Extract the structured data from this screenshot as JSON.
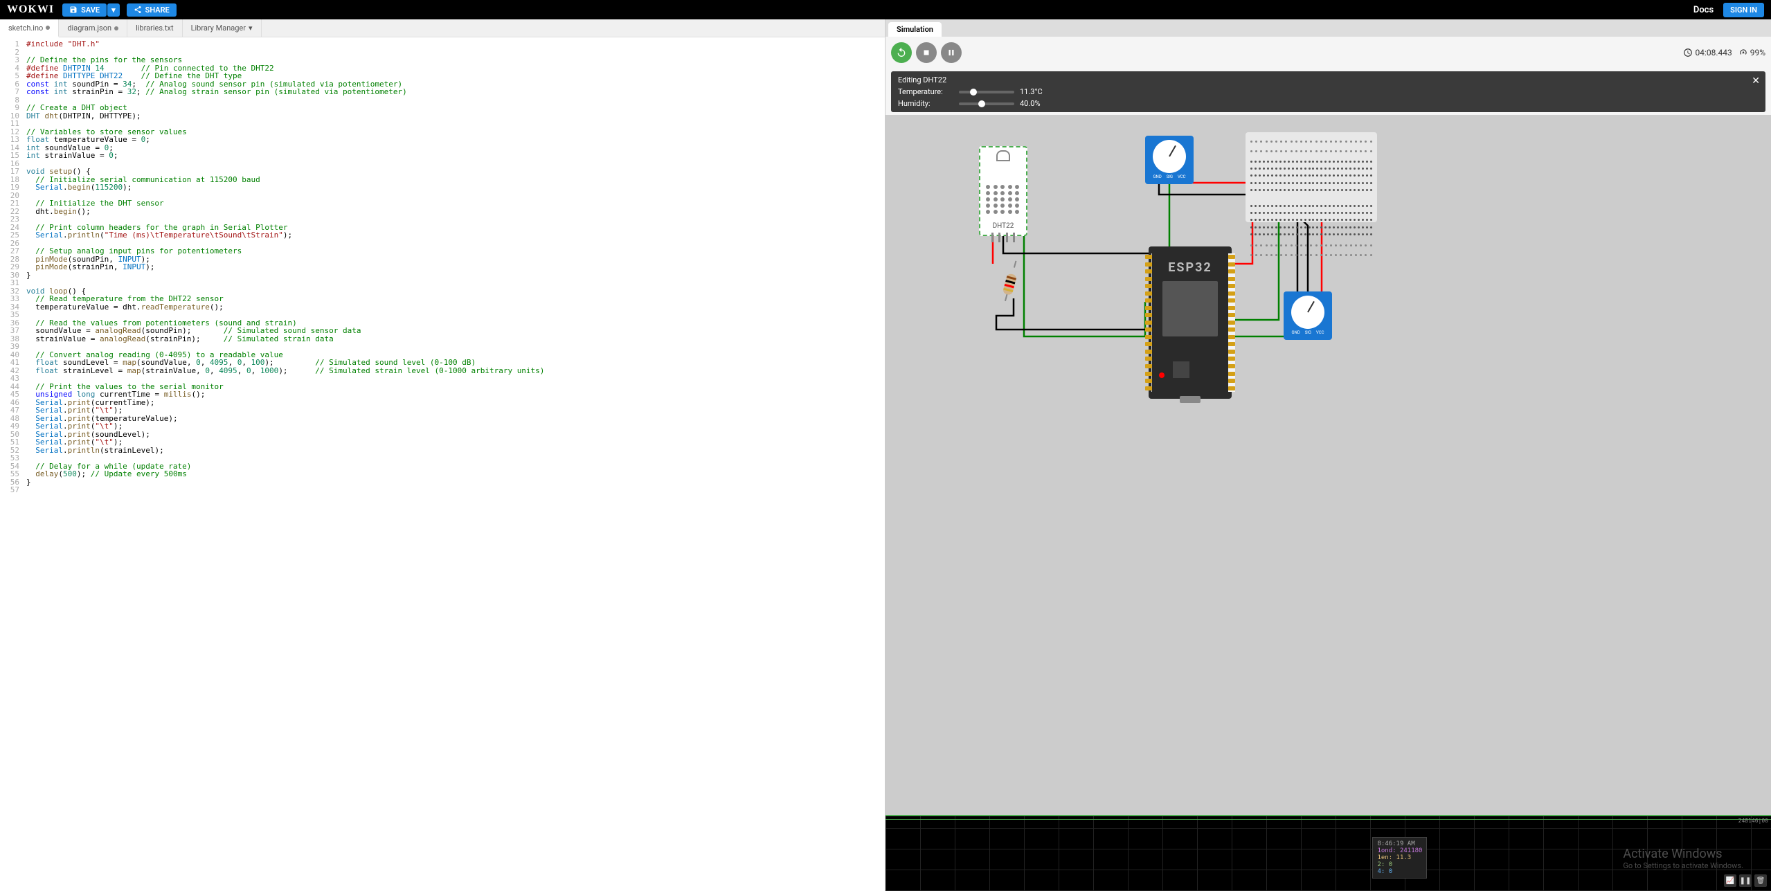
{
  "header": {
    "logo": "WOKWI",
    "save": "SAVE",
    "share": "SHARE",
    "docs": "Docs",
    "signin": "SIGN IN"
  },
  "tabs": [
    {
      "label": "sketch.ino",
      "dirty": true,
      "active": true
    },
    {
      "label": "diagram.json",
      "dirty": true,
      "active": false
    },
    {
      "label": "libraries.txt",
      "dirty": false,
      "active": false
    },
    {
      "label": "Library Manager",
      "dirty": false,
      "active": false,
      "dropdown": true
    }
  ],
  "code_lines": [
    {
      "n": 1,
      "html": "<span class='tk-pp'>#include</span> <span class='tk-str'>\"DHT.h\"</span>"
    },
    {
      "n": 2,
      "html": ""
    },
    {
      "n": 3,
      "html": "<span class='tk-cm'>// Define the pins for the sensors</span>"
    },
    {
      "n": 4,
      "html": "<span class='tk-pp'>#define</span> <span class='tk-const'>DHTPIN</span> <span class='tk-num'>14</span>        <span class='tk-cm'>// Pin connected to the DHT22</span>"
    },
    {
      "n": 5,
      "html": "<span class='tk-pp'>#define</span> <span class='tk-const'>DHTTYPE</span> <span class='tk-const'>DHT22</span>    <span class='tk-cm'>// Define the DHT type</span>"
    },
    {
      "n": 6,
      "html": "<span class='tk-kw'>const</span> <span class='tk-ty'>int</span> soundPin = <span class='tk-num'>34</span>;  <span class='tk-cm'>// Analog sound sensor pin (simulated via potentiometer)</span>"
    },
    {
      "n": 7,
      "html": "<span class='tk-kw'>const</span> <span class='tk-ty'>int</span> strainPin = <span class='tk-num'>32</span>; <span class='tk-cm'>// Analog strain sensor pin (simulated via potentiometer)</span>"
    },
    {
      "n": 8,
      "html": ""
    },
    {
      "n": 9,
      "html": "<span class='tk-cm'>// Create a DHT object</span>"
    },
    {
      "n": 10,
      "html": "<span class='tk-ty'>DHT</span> <span class='tk-fn'>dht</span>(DHTPIN, DHTTYPE);"
    },
    {
      "n": 11,
      "html": ""
    },
    {
      "n": 12,
      "html": "<span class='tk-cm'>// Variables to store sensor values</span>"
    },
    {
      "n": 13,
      "html": "<span class='tk-ty'>float</span> temperatureValue = <span class='tk-num'>0</span>;"
    },
    {
      "n": 14,
      "html": "<span class='tk-ty'>int</span> soundValue = <span class='tk-num'>0</span>;"
    },
    {
      "n": 15,
      "html": "<span class='tk-ty'>int</span> strainValue = <span class='tk-num'>0</span>;"
    },
    {
      "n": 16,
      "html": ""
    },
    {
      "n": 17,
      "html": "<span class='tk-ty'>void</span> <span class='tk-fn'>setup</span>() {"
    },
    {
      "n": 18,
      "html": "  <span class='tk-cm'>// Initialize serial communication at 115200 baud</span>"
    },
    {
      "n": 19,
      "html": "  <span class='tk-const'>Serial</span>.<span class='tk-fn'>begin</span>(<span class='tk-num'>115200</span>);"
    },
    {
      "n": 20,
      "html": ""
    },
    {
      "n": 21,
      "html": "  <span class='tk-cm'>// Initialize the DHT sensor</span>"
    },
    {
      "n": 22,
      "html": "  dht.<span class='tk-fn'>begin</span>();"
    },
    {
      "n": 23,
      "html": ""
    },
    {
      "n": 24,
      "html": "  <span class='tk-cm'>// Print column headers for the graph in Serial Plotter</span>"
    },
    {
      "n": 25,
      "html": "  <span class='tk-const'>Serial</span>.<span class='tk-fn'>println</span>(<span class='tk-str'>\"Time (ms)\\tTemperature\\tSound\\tStrain\"</span>);"
    },
    {
      "n": 26,
      "html": ""
    },
    {
      "n": 27,
      "html": "  <span class='tk-cm'>// Setup analog input pins for potentiometers</span>"
    },
    {
      "n": 28,
      "html": "  <span class='tk-fn'>pinMode</span>(soundPin, <span class='tk-const'>INPUT</span>);"
    },
    {
      "n": 29,
      "html": "  <span class='tk-fn'>pinMode</span>(strainPin, <span class='tk-const'>INPUT</span>);"
    },
    {
      "n": 30,
      "html": "}"
    },
    {
      "n": 31,
      "html": ""
    },
    {
      "n": 32,
      "html": "<span class='tk-ty'>void</span> <span class='tk-fn'>loop</span>() {"
    },
    {
      "n": 33,
      "html": "  <span class='tk-cm'>// Read temperature from the DHT22 sensor</span>"
    },
    {
      "n": 34,
      "html": "  temperatureValue = dht.<span class='tk-fn'>readTemperature</span>();"
    },
    {
      "n": 35,
      "html": ""
    },
    {
      "n": 36,
      "html": "  <span class='tk-cm'>// Read the values from potentiometers (sound and strain)</span>"
    },
    {
      "n": 37,
      "html": "  soundValue = <span class='tk-fn'>analogRead</span>(soundPin);       <span class='tk-cm'>// Simulated sound sensor data</span>"
    },
    {
      "n": 38,
      "html": "  strainValue = <span class='tk-fn'>analogRead</span>(strainPin);     <span class='tk-cm'>// Simulated strain data</span>"
    },
    {
      "n": 39,
      "html": ""
    },
    {
      "n": 40,
      "html": "  <span class='tk-cm'>// Convert analog reading (0-4095) to a readable value</span>"
    },
    {
      "n": 41,
      "html": "  <span class='tk-ty'>float</span> soundLevel = <span class='tk-fn'>map</span>(soundValue, <span class='tk-num'>0</span>, <span class='tk-num'>4095</span>, <span class='tk-num'>0</span>, <span class='tk-num'>100</span>);         <span class='tk-cm'>// Simulated sound level (0-100 dB)</span>"
    },
    {
      "n": 42,
      "html": "  <span class='tk-ty'>float</span> strainLevel = <span class='tk-fn'>map</span>(strainValue, <span class='tk-num'>0</span>, <span class='tk-num'>4095</span>, <span class='tk-num'>0</span>, <span class='tk-num'>1000</span>);      <span class='tk-cm'>// Simulated strain level (0-1000 arbitrary units)</span>"
    },
    {
      "n": 43,
      "html": ""
    },
    {
      "n": 44,
      "html": "  <span class='tk-cm'>// Print the values to the serial monitor</span>"
    },
    {
      "n": 45,
      "html": "  <span class='tk-kw'>unsigned</span> <span class='tk-ty'>long</span> currentTime = <span class='tk-fn'>millis</span>();"
    },
    {
      "n": 46,
      "html": "  <span class='tk-const'>Serial</span>.<span class='tk-fn'>print</span>(currentTime);"
    },
    {
      "n": 47,
      "html": "  <span class='tk-const'>Serial</span>.<span class='tk-fn'>print</span>(<span class='tk-str'>\"\\t\"</span>);"
    },
    {
      "n": 48,
      "html": "  <span class='tk-const'>Serial</span>.<span class='tk-fn'>print</span>(temperatureValue);"
    },
    {
      "n": 49,
      "html": "  <span class='tk-const'>Serial</span>.<span class='tk-fn'>print</span>(<span class='tk-str'>\"\\t\"</span>);"
    },
    {
      "n": 50,
      "html": "  <span class='tk-const'>Serial</span>.<span class='tk-fn'>print</span>(soundLevel);"
    },
    {
      "n": 51,
      "html": "  <span class='tk-const'>Serial</span>.<span class='tk-fn'>print</span>(<span class='tk-str'>\"\\t\"</span>);"
    },
    {
      "n": 52,
      "html": "  <span class='tk-const'>Serial</span>.<span class='tk-fn'>println</span>(strainLevel);"
    },
    {
      "n": 53,
      "html": ""
    },
    {
      "n": 54,
      "html": "  <span class='tk-cm'>// Delay for a while (update rate)</span>"
    },
    {
      "n": 55,
      "html": "  <span class='tk-fn'>delay</span>(<span class='tk-num'>500</span>); <span class='tk-cm'>// Update every 500ms</span>"
    },
    {
      "n": 56,
      "html": "}"
    },
    {
      "n": 57,
      "html": ""
    }
  ],
  "sim": {
    "tab": "Simulation",
    "time": "04:08.443",
    "perf": "99%"
  },
  "dht_panel": {
    "title": "Editing DHT22",
    "temp_label": "Temperature:",
    "temp_value": "11.3°C",
    "hum_label": "Humidity:",
    "hum_value": "40.0%"
  },
  "components": {
    "dht22_label": "DHT22",
    "esp32_label": "ESP32",
    "pot_pins": [
      "GND",
      "SIG",
      "VCC"
    ]
  },
  "plotter": {
    "top_right": "248146|00",
    "tooltip_time": "8:46:19 AM",
    "lines": [
      {
        "cls": "r-purple",
        "text": "1ond: 241180"
      },
      {
        "cls": "r-orange",
        "text": "1en: 11.3"
      },
      {
        "cls": "r-green",
        "text": "2: 0"
      },
      {
        "cls": "r-blue",
        "text": "4: 0"
      }
    ]
  },
  "watermark": {
    "title": "Activate Windows",
    "sub": "Go to Settings to activate Windows."
  }
}
